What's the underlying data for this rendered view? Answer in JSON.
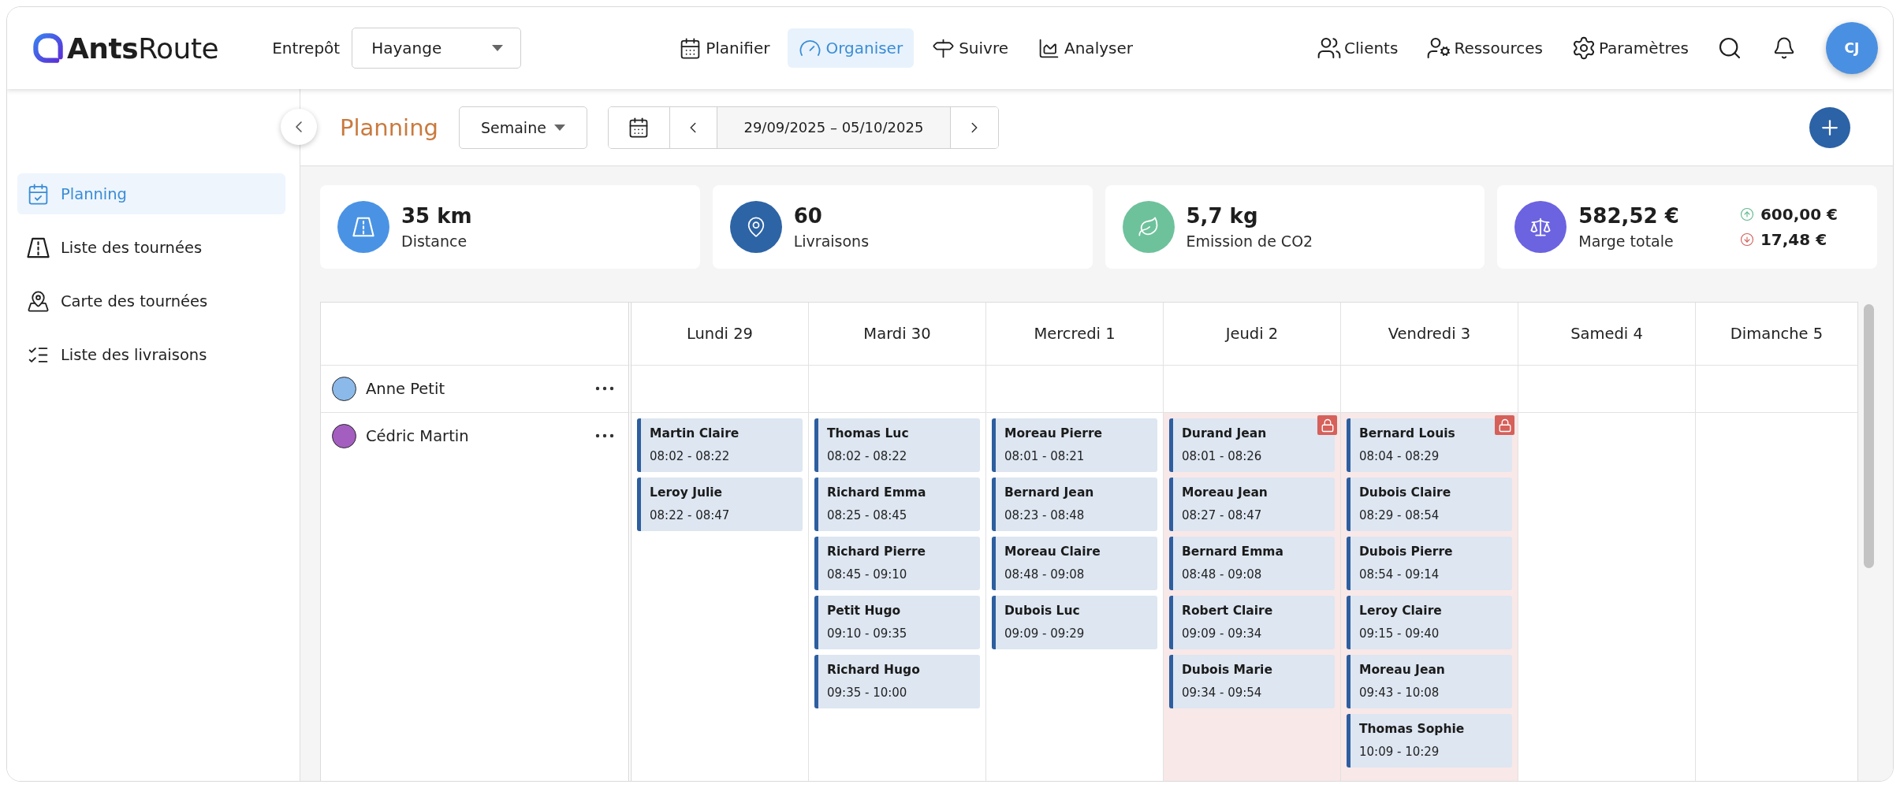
{
  "header": {
    "logo": "**Ants**Route",
    "warehouse": {
      "label": "Entrepôt",
      "value": "Hayange"
    },
    "nav": [
      {
        "label": "Planifier",
        "selected": false
      },
      {
        "label": "Organiser",
        "selected": true
      },
      {
        "label": "Suivre",
        "selected": false
      },
      {
        "label": "Analyser",
        "selected": false
      }
    ],
    "tools": [
      "Clients",
      "Ressources",
      "Paramètres"
    ],
    "avatar": "CJ"
  },
  "sidebar": {
    "items": [
      {
        "label": "Planning",
        "selected": true
      },
      {
        "label": "Liste des tournées",
        "selected": false
      },
      {
        "label": "Carte des tournées",
        "selected": false
      },
      {
        "label": "Liste des livraisons",
        "selected": false
      }
    ]
  },
  "toolbar": {
    "title": "Planning",
    "view": "Semaine",
    "date_range": "29/09/2025 – 05/10/2025"
  },
  "stats": [
    {
      "value": "35 km",
      "label": "Distance"
    },
    {
      "value": "60",
      "label": "Livraisons"
    },
    {
      "value": "5,7 kg",
      "label": "Emission de CO2"
    },
    {
      "value": "582,52 €",
      "label": "Marge totale",
      "income": "600,00 €",
      "cost": "17,48 €"
    }
  ],
  "calendar": {
    "days": [
      "Lundi 29",
      "Mardi 30",
      "Mercredi 1",
      "Jeudi 2",
      "Vendredi 3",
      "Samedi 4",
      "Dimanche 5"
    ],
    "resources": [
      {
        "name": "Anne Petit",
        "color": "#8bb9e9",
        "days": [
          {
            "locked": false
          },
          {
            "locked": false
          },
          {
            "locked": false
          },
          {
            "locked": false
          },
          {
            "locked": false
          },
          {
            "locked": false
          },
          {
            "locked": false
          }
        ]
      },
      {
        "name": "Cédric Martin",
        "color": "#a35ebf",
        "days": [
          {
            "locked": false,
            "stops": [
              {
                "name": "Martin Claire",
                "time": "08:02 - 08:22"
              },
              {
                "name": "Leroy Julie",
                "time": "08:22 - 08:47"
              }
            ]
          },
          {
            "locked": false,
            "stops": [
              {
                "name": "Thomas Luc",
                "time": "08:02 - 08:22"
              },
              {
                "name": "Richard Emma",
                "time": "08:25 - 08:45"
              },
              {
                "name": "Richard Pierre",
                "time": "08:45 - 09:10"
              },
              {
                "name": "Petit Hugo",
                "time": "09:10 - 09:35"
              },
              {
                "name": "Richard Hugo",
                "time": "09:35 - 10:00"
              }
            ]
          },
          {
            "locked": false,
            "stops": [
              {
                "name": "Moreau Pierre",
                "time": "08:01 - 08:21"
              },
              {
                "name": "Bernard Jean",
                "time": "08:23 - 08:48"
              },
              {
                "name": "Moreau Claire",
                "time": "08:48 - 09:08"
              },
              {
                "name": "Dubois Luc",
                "time": "09:09 - 09:29"
              }
            ]
          },
          {
            "locked": true,
            "stops": [
              {
                "name": "Durand Jean",
                "time": "08:01 - 08:26"
              },
              {
                "name": "Moreau Jean",
                "time": "08:27 - 08:47"
              },
              {
                "name": "Bernard Emma",
                "time": "08:48 - 09:08"
              },
              {
                "name": "Robert Claire",
                "time": "09:09 - 09:34"
              },
              {
                "name": "Dubois Marie",
                "time": "09:34 - 09:54"
              }
            ]
          },
          {
            "locked": true,
            "stops": [
              {
                "name": "Bernard Louis",
                "time": "08:04 - 08:29"
              },
              {
                "name": "Dubois Claire",
                "time": "08:29 - 08:54"
              },
              {
                "name": "Dubois Pierre",
                "time": "08:54 - 09:14"
              },
              {
                "name": "Leroy Claire",
                "time": "09:15 - 09:40"
              },
              {
                "name": "Moreau Jean",
                "time": "09:43 - 10:08"
              },
              {
                "name": "Thomas Sophie",
                "time": "10:09 - 10:29"
              }
            ]
          },
          {
            "locked": false
          },
          {
            "locked": false
          }
        ]
      }
    ]
  }
}
